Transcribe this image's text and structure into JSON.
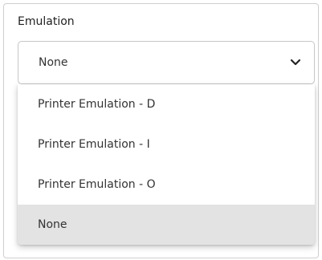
{
  "section": {
    "label": "Emulation"
  },
  "select": {
    "value": "None",
    "icon": "chevron-down-icon"
  },
  "menu": {
    "options": [
      {
        "label": "Printer Emulation - D"
      },
      {
        "label": "Printer Emulation - I"
      },
      {
        "label": "Printer Emulation - O"
      },
      {
        "label": "None",
        "selected": true
      }
    ]
  },
  "colors": {
    "selected_bg": "#e3e3e3",
    "border": "#cfcfcf"
  }
}
